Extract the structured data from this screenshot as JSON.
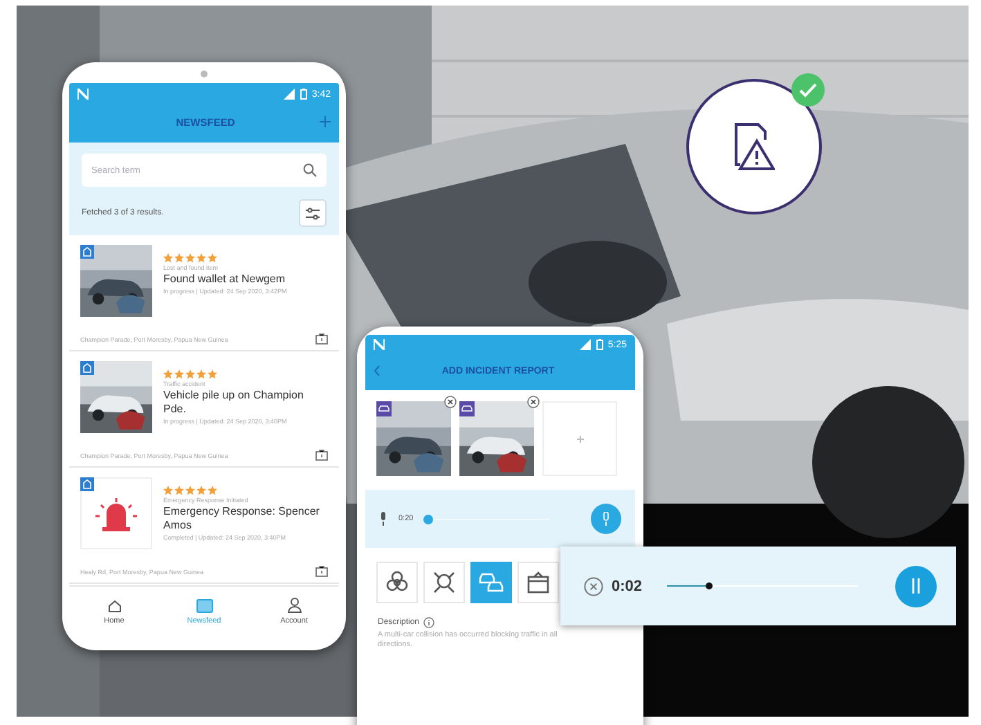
{
  "newsfeed_phone": {
    "status_time": "3:42",
    "title": "NEWSFEED",
    "search": {
      "placeholder": "Search term"
    },
    "results_text": "Fetched 3 of 3 results.",
    "cards": [
      {
        "stars": 5,
        "category": "Lost and found item",
        "title": "Found wallet at Newgem",
        "status": "In progress | Updated: 24 Sep 2020, 3:42PM",
        "location": "Champion Parade, Port Moresby, Papua New Guinea"
      },
      {
        "stars": 5,
        "category": "Traffic accident",
        "title": "Vehicle pile up on Champion Pde.",
        "status": "In progress | Updated: 24 Sep 2020, 3:40PM",
        "location": "Champion Parade, Port Moresby, Papua New Guinea"
      },
      {
        "kind": "siren",
        "stars": 5,
        "category": "Emergency Response Initiated",
        "title": "Emergency Response: Spencer Amos",
        "status": "Completed | Updated: 24 Sep 2020, 3:40PM",
        "location": "Healy Rd, Port Moresby, Papua New Guinea"
      }
    ],
    "nav": [
      {
        "kind": "home",
        "label": "Home",
        "selected": false
      },
      {
        "kind": "newsfeed",
        "label": "Newsfeed",
        "selected": true
      },
      {
        "kind": "account",
        "label": "Account",
        "selected": false
      }
    ]
  },
  "report_phone": {
    "status_time": "5:25",
    "title": "ADD INCIDENT REPORT",
    "recording": {
      "time": "0:20",
      "level": 0.02
    },
    "categories": [
      {
        "kind": "biohazard",
        "selected": false
      },
      {
        "kind": "hazard",
        "selected": false
      },
      {
        "kind": "collision",
        "selected": true
      },
      {
        "kind": "package",
        "selected": false
      }
    ],
    "description": {
      "label": "Description",
      "text": "A multi-car collision has occurred blocking traffic in all directions."
    }
  },
  "audio_popup": {
    "time": "0:02",
    "level": 0.22,
    "playing": true
  },
  "badge": {
    "checked": true
  }
}
